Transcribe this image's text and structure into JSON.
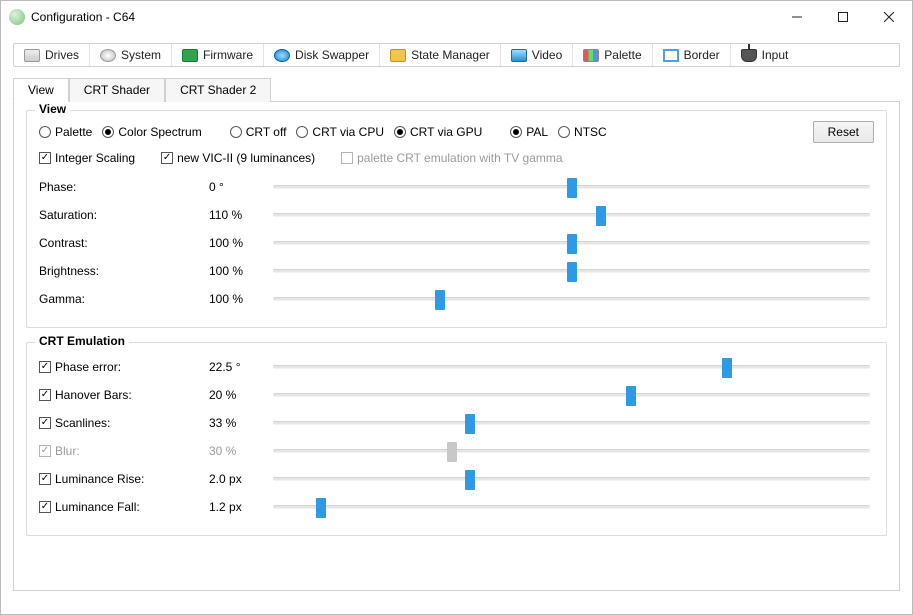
{
  "window": {
    "title": "Configuration - C64"
  },
  "tabs": [
    {
      "label": "Drives"
    },
    {
      "label": "System"
    },
    {
      "label": "Firmware"
    },
    {
      "label": "Disk Swapper"
    },
    {
      "label": "State Manager"
    },
    {
      "label": "Video"
    },
    {
      "label": "Palette"
    },
    {
      "label": "Border"
    },
    {
      "label": "Input"
    }
  ],
  "subtabs": [
    {
      "label": "View"
    },
    {
      "label": "CRT Shader"
    },
    {
      "label": "CRT Shader 2"
    }
  ],
  "view": {
    "legend": "View",
    "radios1": {
      "palette": "Palette",
      "spectrum": "Color Spectrum",
      "crtOff": "CRT off",
      "crtCpu": "CRT via CPU",
      "crtGpu": "CRT via GPU",
      "pal": "PAL",
      "ntsc": "NTSC"
    },
    "checks": {
      "intScaling": "Integer Scaling",
      "newVic": "new VIC-II (9 luminances)",
      "palCrtGamma": "palette CRT emulation with TV gamma"
    },
    "reset": "Reset",
    "sliders": {
      "phase": {
        "label": "Phase:",
        "value": "0 °",
        "pos": 50
      },
      "saturation": {
        "label": "Saturation:",
        "value": "110 %",
        "pos": 55
      },
      "contrast": {
        "label": "Contrast:",
        "value": "100 %",
        "pos": 50
      },
      "brightness": {
        "label": "Brightness:",
        "value": "100 %",
        "pos": 50
      },
      "gamma": {
        "label": "Gamma:",
        "value": "100 %",
        "pos": 28
      }
    }
  },
  "crt": {
    "legend": "CRT Emulation",
    "sliders": {
      "phaseErr": {
        "label": "Phase error:",
        "value": "22.5 °",
        "pos": 76
      },
      "hanover": {
        "label": "Hanover Bars:",
        "value": "20 %",
        "pos": 60
      },
      "scanlines": {
        "label": "Scanlines:",
        "value": "33 %",
        "pos": 33
      },
      "blur": {
        "label": "Blur:",
        "value": "30 %",
        "pos": 30
      },
      "lumRise": {
        "label": "Luminance Rise:",
        "value": "2.0 px",
        "pos": 33
      },
      "lumFall": {
        "label": "Luminance Fall:",
        "value": "1.2 px",
        "pos": 8
      }
    }
  }
}
